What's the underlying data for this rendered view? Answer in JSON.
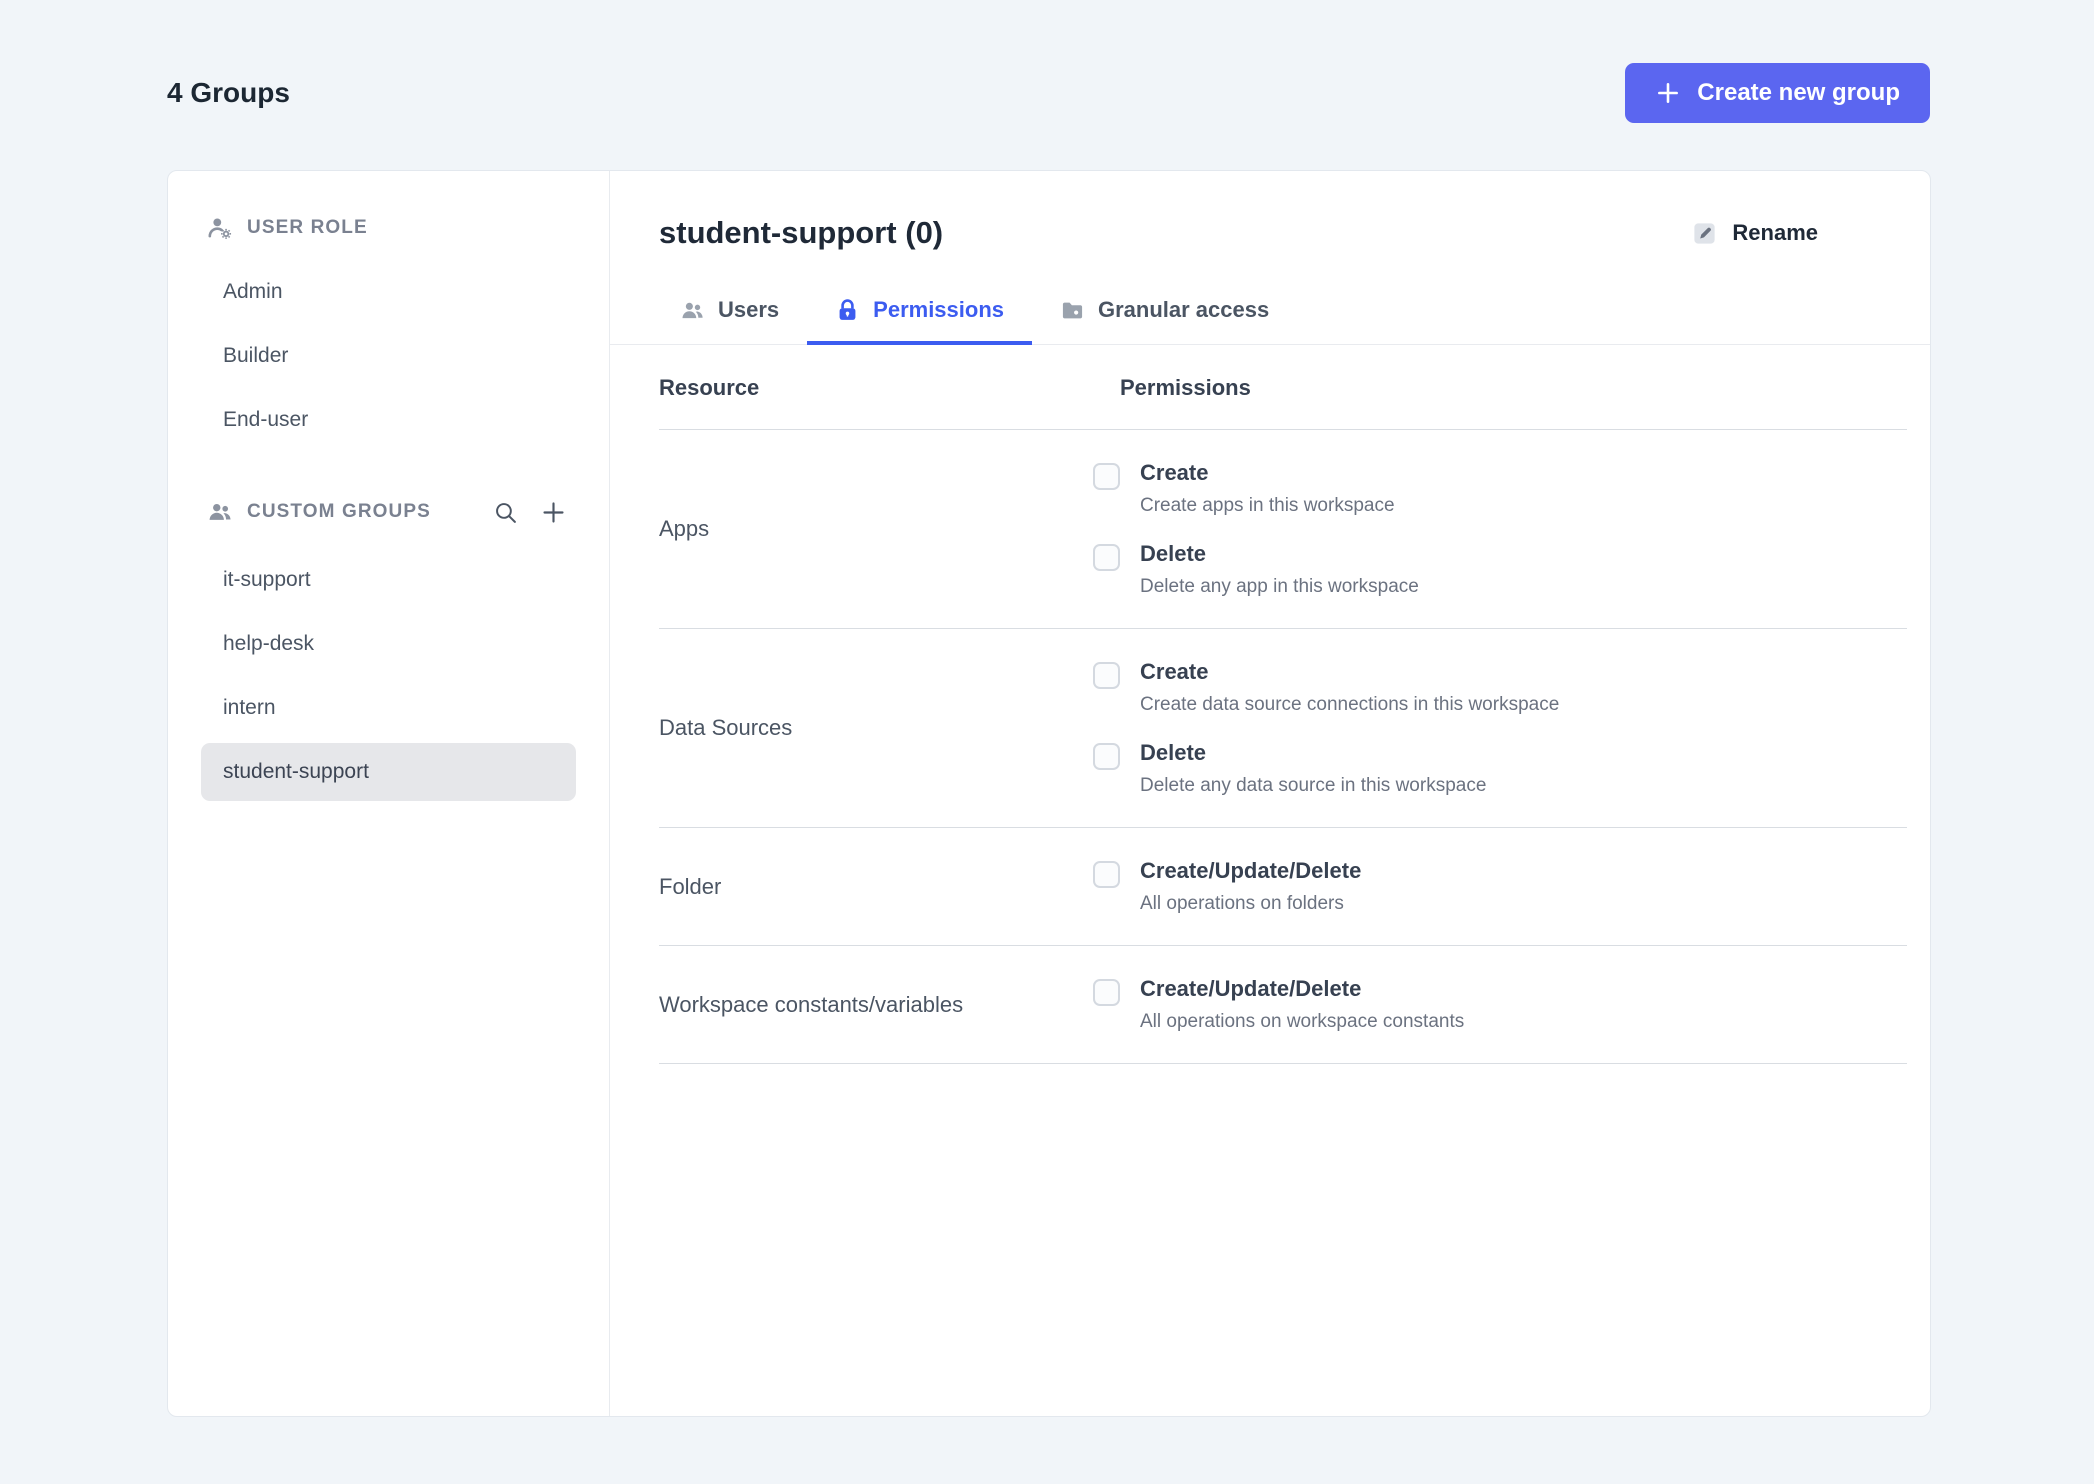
{
  "page": {
    "title": "4 Groups",
    "create_button_label": "Create new group"
  },
  "sidebar": {
    "user_role": {
      "header": "USER ROLE",
      "items": [
        {
          "label": "Admin",
          "selected": false
        },
        {
          "label": "Builder",
          "selected": false
        },
        {
          "label": "End-user",
          "selected": false
        }
      ]
    },
    "custom_groups": {
      "header": "CUSTOM GROUPS",
      "items": [
        {
          "label": "it-support",
          "selected": false
        },
        {
          "label": "help-desk",
          "selected": false
        },
        {
          "label": "intern",
          "selected": false
        },
        {
          "label": "student-support",
          "selected": true
        }
      ]
    }
  },
  "content": {
    "title": "student-support (0)",
    "rename_label": "Rename",
    "tabs": [
      {
        "label": "Users",
        "icon": "users-icon",
        "active": false
      },
      {
        "label": "Permissions",
        "icon": "lock-icon",
        "active": true
      },
      {
        "label": "Granular access",
        "icon": "folder-icon",
        "active": false
      }
    ],
    "table": {
      "headers": {
        "resource": "Resource",
        "permissions": "Permissions"
      },
      "rows": [
        {
          "resource": "Apps",
          "permissions": [
            {
              "label": "Create",
              "description": "Create apps in this workspace",
              "checked": false
            },
            {
              "label": "Delete",
              "description": "Delete any app in this workspace",
              "checked": false
            }
          ]
        },
        {
          "resource": "Data Sources",
          "permissions": [
            {
              "label": "Create",
              "description": "Create data source connections in this workspace",
              "checked": false
            },
            {
              "label": "Delete",
              "description": "Delete any data source in this workspace",
              "checked": false
            }
          ]
        },
        {
          "resource": "Folder",
          "permissions": [
            {
              "label": "Create/Update/Delete",
              "description": "All operations on folders",
              "checked": false
            }
          ]
        },
        {
          "resource": "Workspace constants/variables",
          "permissions": [
            {
              "label": "Create/Update/Delete",
              "description": "All operations on workspace constants",
              "checked": false
            }
          ]
        }
      ]
    }
  },
  "colors": {
    "accent_button": "#5b66f0",
    "accent_tab": "#3c5cf0",
    "background": "#f1f5f9"
  }
}
